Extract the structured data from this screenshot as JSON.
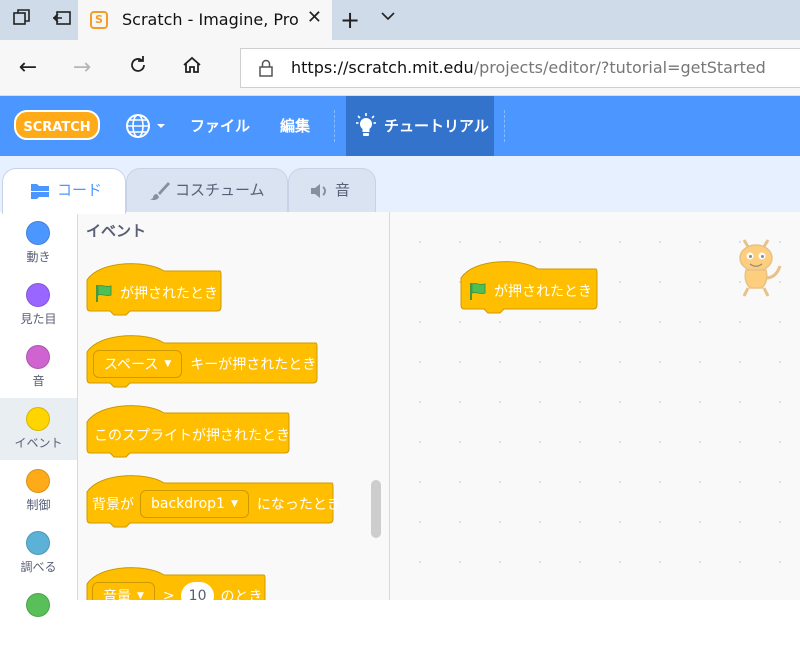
{
  "browser": {
    "tab_title": "Scratch - Imagine, Program, Share",
    "tab_favicon_letter": "S",
    "url_host": "https://scratch.mit.edu",
    "url_path": "/projects/editor/?tutorial=getStarted"
  },
  "menubar": {
    "logo_text": "SCRATCH",
    "file_label": "ファイル",
    "edit_label": "編集",
    "tutorial_label": "チュートリアル",
    "color": "#4c97ff"
  },
  "editor_tabs": [
    {
      "label": "コード"
    },
    {
      "label": "コスチューム"
    },
    {
      "label": "音"
    }
  ],
  "categories": [
    {
      "label": "動き",
      "color": "#4c97ff"
    },
    {
      "label": "見た目",
      "color": "#9966ff"
    },
    {
      "label": "音",
      "color": "#cf63cf"
    },
    {
      "label": "イベント",
      "color": "#ffd500"
    },
    {
      "label": "制御",
      "color": "#ffab19"
    },
    {
      "label": "調べる",
      "color": "#5cb1d6"
    },
    {
      "label": "",
      "color": "#59c059"
    }
  ],
  "palette": {
    "heading": "イベント",
    "blocks": {
      "flag_clicked": "が押されたとき",
      "key_dropdown": "スペース",
      "key_pressed": "キーが押されたとき",
      "sprite_clicked": "このスプライトが押されたとき",
      "backdrop_prefix": "背景が",
      "backdrop_dropdown": "backdrop1",
      "backdrop_suffix": "になったとき",
      "loudness_dropdown": "音量",
      "loudness_op": ">",
      "loudness_value": "10",
      "loudness_suffix": "のとき"
    },
    "block_color": "#ffbf00"
  },
  "workspace": {
    "script_block": "が押されたとき"
  }
}
